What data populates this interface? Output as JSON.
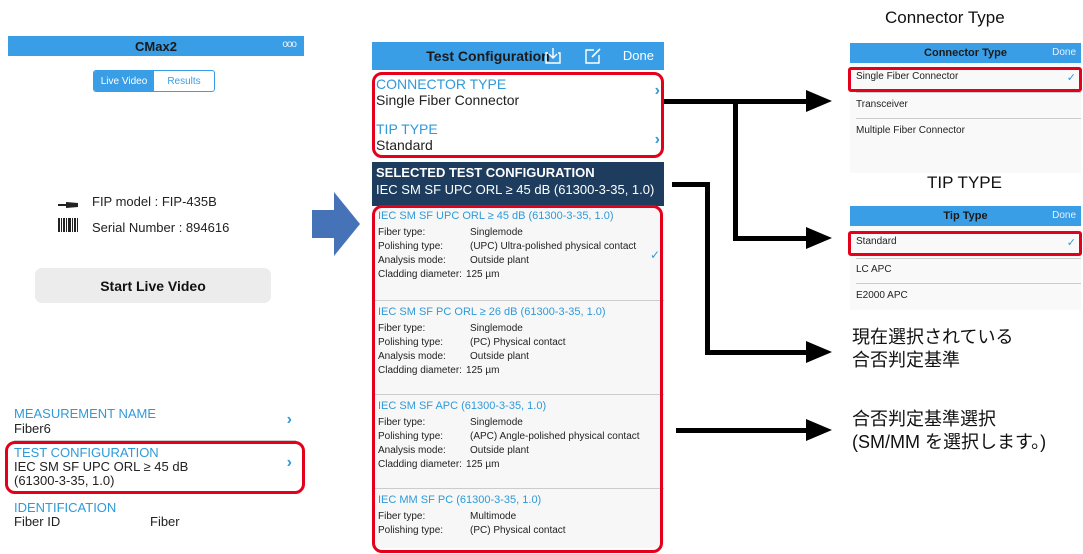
{
  "panel1": {
    "title": "CMax2",
    "more_icon_text": "ooo",
    "tabs": [
      "Live Video",
      "Results"
    ],
    "fip_model": "FIP model : FIP-435B",
    "serial_number": "Serial Number : 894616",
    "start_button": "Start Live Video",
    "measurement_name_label": "MEASUREMENT NAME",
    "measurement_name_value": "Fiber6",
    "test_config_label": "TEST CONFIGURATION",
    "test_config_value_line1": "IEC SM SF UPC ORL ≥ 45 dB",
    "test_config_value_line2": "(61300-3-35, 1.0)",
    "identification_label": "IDENTIFICATION",
    "fiber_id_label": "Fiber ID",
    "fiber_id_value": "Fiber"
  },
  "panel2": {
    "title": "Test Configuration",
    "done": "Done",
    "connector_type_label": "CONNECTOR TYPE",
    "connector_type_value": "Single Fiber Connector",
    "tip_type_label": "TIP TYPE",
    "tip_type_value": "Standard",
    "selected_header": "SELECTED TEST CONFIGURATION",
    "selected_value": "IEC SM SF UPC ORL ≥ 45 dB (61300-3-35, 1.0)",
    "configs": [
      {
        "title": "IEC SM SF UPC ORL ≥ 45 dB (61300-3-35, 1.0)",
        "fiber_type_label": "Fiber type:",
        "fiber_type": "Singlemode",
        "polishing_label": "Polishing type:",
        "polishing": "(UPC) Ultra-polished physical contact",
        "analysis_label": "Analysis mode:",
        "analysis": "Outside plant",
        "cladding_label": "Cladding diameter:",
        "cladding": "125 µm"
      },
      {
        "title": "IEC SM SF PC ORL ≥ 26 dB (61300-3-35, 1.0)",
        "fiber_type_label": "Fiber type:",
        "fiber_type": "Singlemode",
        "polishing_label": "Polishing type:",
        "polishing": "(PC) Physical contact",
        "analysis_label": "Analysis mode:",
        "analysis": "Outside plant",
        "cladding_label": "Cladding diameter:",
        "cladding": "125 µm"
      },
      {
        "title": "IEC SM SF APC (61300-3-35, 1.0)",
        "fiber_type_label": "Fiber type:",
        "fiber_type": "Singlemode",
        "polishing_label": "Polishing type:",
        "polishing": "(APC) Angle-polished physical contact",
        "analysis_label": "Analysis mode:",
        "analysis": "Outside plant",
        "cladding_label": "Cladding diameter:",
        "cladding": "125 µm"
      },
      {
        "title": "IEC MM SF PC (61300-3-35, 1.0)",
        "fiber_type_label": "Fiber type:",
        "fiber_type": "Multimode",
        "polishing_label": "Polishing type:",
        "polishing": "(PC) Physical contact"
      }
    ]
  },
  "connector_panel": {
    "caption": "Connector Type",
    "title": "Connector Type",
    "done": "Done",
    "options": [
      "Single Fiber Connector",
      "Transceiver",
      "Multiple Fiber Connector"
    ]
  },
  "tip_panel": {
    "caption": "TIP TYPE",
    "title": "Tip Type",
    "done": "Done",
    "options": [
      "Standard",
      "LC APC",
      "E2000 APC"
    ]
  },
  "annotations": {
    "current_line1": "現在選択されている",
    "current_line2": "合否判定基準",
    "select_line1": "合否判定基準選択",
    "select_line2": "(SM/MM を選択します。)"
  },
  "colors": {
    "accent": "#3a9ee6",
    "highlight": "#e4001b",
    "dark_header": "#1d3c5e",
    "big_arrow": "#4673b8"
  }
}
